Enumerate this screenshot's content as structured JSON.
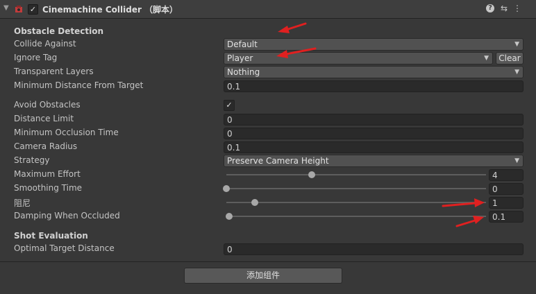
{
  "component": {
    "title": "Cinemachine Collider （脚本）",
    "enabled_check": "✓",
    "help_icon": "?",
    "settings_icon": "⇆",
    "menu_icon": "⋮"
  },
  "sections": {
    "obstacle_detection": "Obstacle Detection",
    "shot_evaluation": "Shot Evaluation"
  },
  "fields": {
    "collide_against": {
      "label": "Collide Against",
      "value": "Default"
    },
    "ignore_tag": {
      "label": "Ignore Tag",
      "value": "Player",
      "clear_label": "Clear"
    },
    "transparent_layers": {
      "label": "Transparent Layers",
      "value": "Nothing"
    },
    "min_distance_from_target": {
      "label": "Minimum Distance From Target",
      "value": "0.1"
    },
    "avoid_obstacles": {
      "label": "Avoid Obstacles",
      "checked": true,
      "check": "✓"
    },
    "distance_limit": {
      "label": "Distance Limit",
      "value": "0"
    },
    "min_occlusion_time": {
      "label": "Minimum Occlusion Time",
      "value": "0"
    },
    "camera_radius": {
      "label": "Camera Radius",
      "value": "0.1"
    },
    "strategy": {
      "label": "Strategy",
      "value": "Preserve Camera Height"
    },
    "maximum_effort": {
      "label": "Maximum Effort",
      "value": "4",
      "fraction": 0.33
    },
    "smoothing_time": {
      "label": "Smoothing Time",
      "value": "0",
      "fraction": 0.0
    },
    "damping": {
      "label": "阻尼",
      "value": "1",
      "fraction": 0.11
    },
    "damping_when_occluded": {
      "label": "Damping When Occluded",
      "value": "0.1",
      "fraction": 0.01
    },
    "optimal_target_distance": {
      "label": "Optimal Target Distance",
      "value": "0"
    }
  },
  "footer": {
    "add_component_label": "添加组件"
  },
  "colors": {
    "background": "#383838",
    "field": "#2a2a2a",
    "dropdown": "#515151",
    "annotation_arrow": "#e02020"
  }
}
